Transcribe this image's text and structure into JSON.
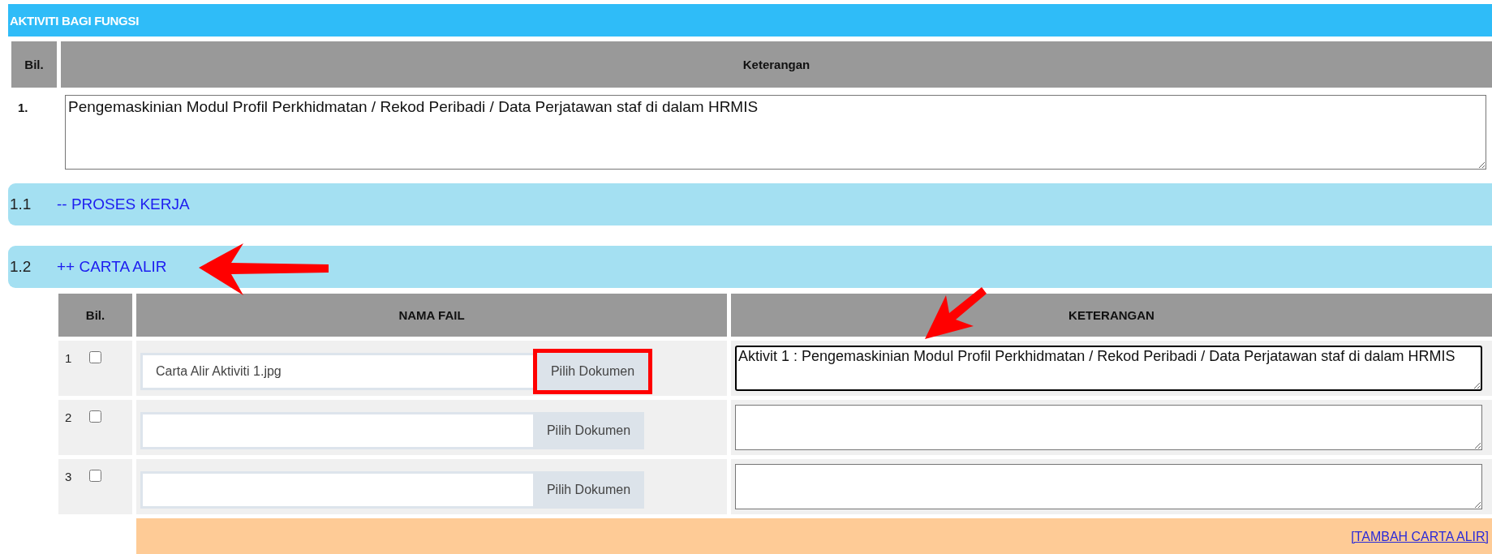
{
  "section_title": "AKTIVITI BAGI FUNGSI",
  "activity_table": {
    "columns": [
      "Bil.",
      "Keterangan"
    ],
    "rows": [
      {
        "number": "1.",
        "description": "Pengemaskinian Modul Profil Perkhidmatan / Rekod Peribadi / Data Perjatawan staf di dalam HRMIS"
      }
    ]
  },
  "groups": [
    {
      "number": "1.1",
      "label": "-- PROSES KERJA"
    },
    {
      "number": "1.2",
      "label": "++ CARTA ALIR"
    }
  ],
  "file_table": {
    "columns": [
      "Bil.",
      "NAMA FAIL",
      "KETERANGAN"
    ],
    "rows": [
      {
        "number": "1",
        "checked": false,
        "file_name": "Carta Alir Aktiviti 1.jpg",
        "button": "Pilih Dokumen",
        "highlighted": true,
        "description": "Aktivit 1 : Pengemaskinian Modul Profil Perkhidmatan / Rekod Peribadi / Data Perjatawan staf di dalam HRMIS",
        "focused": true
      },
      {
        "number": "2",
        "checked": false,
        "button": "Pilih Dokumen",
        "highlighted": false,
        "focused": false
      },
      {
        "number": "3",
        "checked": false,
        "button": "Pilih Dokumen",
        "highlighted": false,
        "focused": false
      }
    ],
    "add_link": "[TAMBAH CARTA ALIR]"
  },
  "annotations": [
    {
      "kind": "arrow"
    },
    {
      "kind": "arrow"
    }
  ]
}
